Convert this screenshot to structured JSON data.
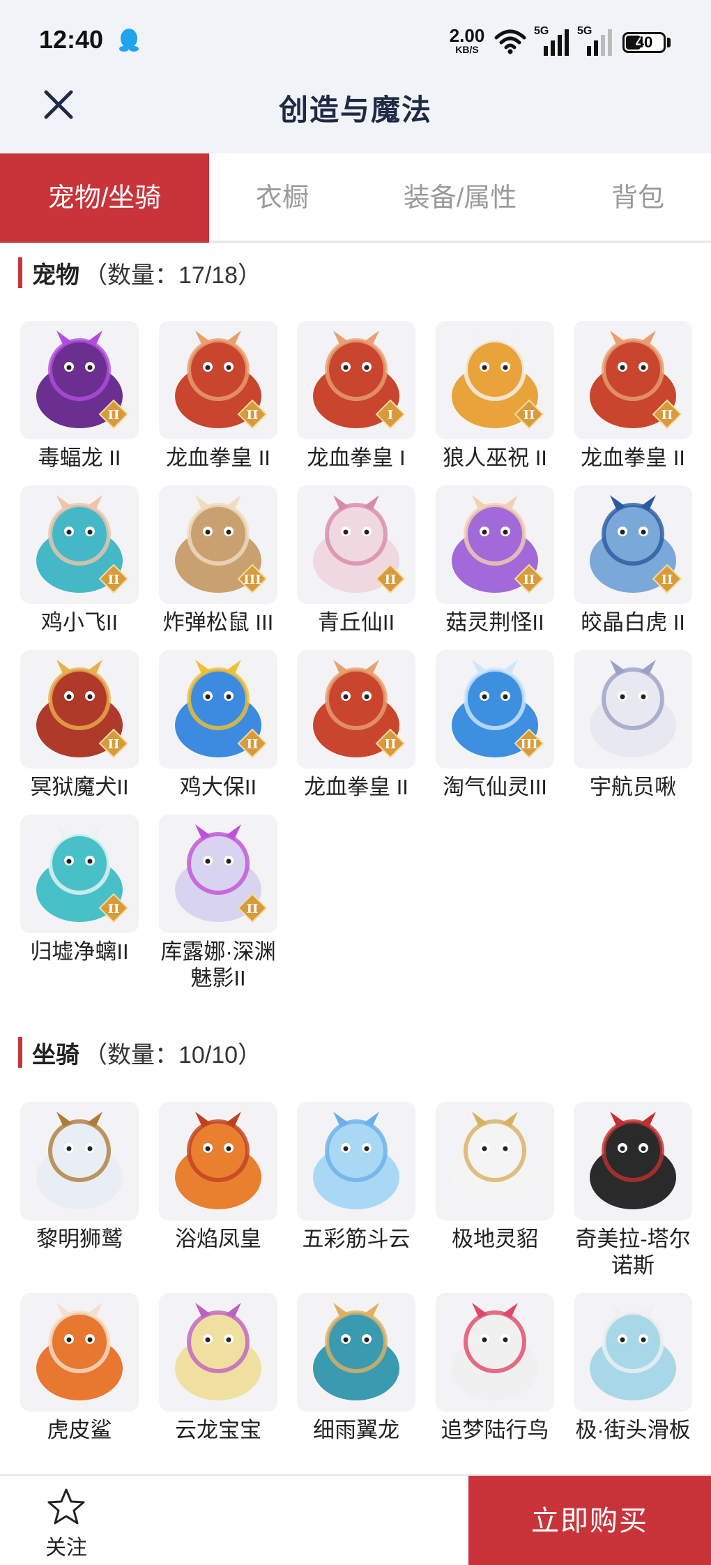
{
  "status_bar": {
    "time": "12:40",
    "net_speed_value": "2.00",
    "net_speed_unit": "KB/S",
    "signal_1_label": "5G",
    "signal_2_label": "5G",
    "battery_level": 40,
    "battery_text": "40"
  },
  "header": {
    "title": "创造与魔法"
  },
  "tabs": [
    {
      "label": "宠物/坐骑",
      "active": true
    },
    {
      "label": "衣橱",
      "active": false
    },
    {
      "label": "装备/属性",
      "active": false
    },
    {
      "label": "背包",
      "active": false
    }
  ],
  "pets_section": {
    "title": "宠物",
    "count": "（数量：17/18）",
    "items": [
      {
        "name": "毒蝠龙 II",
        "tier": "II",
        "color": "#6b2f8f",
        "accent": "#b24ce0"
      },
      {
        "name": "龙血拳皇 II",
        "tier": "II",
        "color": "#c9452e",
        "accent": "#e8a070"
      },
      {
        "name": "龙血拳皇 I",
        "tier": "I",
        "color": "#c9452e",
        "accent": "#e8a070"
      },
      {
        "name": "狼人巫祝 II",
        "tier": "II",
        "color": "#e8a43a",
        "accent": "#f2f2f2"
      },
      {
        "name": "龙血拳皇 II",
        "tier": "II",
        "color": "#c9452e",
        "accent": "#e8a070"
      },
      {
        "name": "鸡小飞II",
        "tier": "II",
        "color": "#45b8c8",
        "accent": "#f0c4a8"
      },
      {
        "name": "炸弹松鼠 III",
        "tier": "III",
        "color": "#c9a070",
        "accent": "#f0dcc0"
      },
      {
        "name": "青丘仙II",
        "tier": "II",
        "color": "#f0d8e0",
        "accent": "#d88aa8"
      },
      {
        "name": "菇灵荆怪II",
        "tier": "II",
        "color": "#a26ad8",
        "accent": "#f3d0b0"
      },
      {
        "name": "皎晶白虎 II",
        "tier": "II",
        "color": "#7aa8d8",
        "accent": "#2c5aa0"
      },
      {
        "name": "冥狱魔犬II",
        "tier": "II",
        "color": "#b03a2a",
        "accent": "#e8b04a"
      },
      {
        "name": "鸡大保II",
        "tier": "II",
        "color": "#3d8be0",
        "accent": "#f0c030"
      },
      {
        "name": "龙血拳皇 II",
        "tier": "II",
        "color": "#c9452e",
        "accent": "#e8a070"
      },
      {
        "name": "淘气仙灵III",
        "tier": "III",
        "color": "#3d8fe0",
        "accent": "#cfe6fa"
      },
      {
        "name": "宇航员啾",
        "tier": "",
        "color": "#e8e8f0",
        "accent": "#9aa0c8"
      },
      {
        "name": "归墟净螭II",
        "tier": "II",
        "color": "#48c0c8",
        "accent": "#e8f4f4"
      },
      {
        "name": "库露娜·深渊魅影II",
        "tier": "II",
        "color": "#d8d4f0",
        "accent": "#c050d8"
      }
    ]
  },
  "mounts_section": {
    "title": "坐骑",
    "count": "（数量：10/10）",
    "items": [
      {
        "name": "黎明狮鹫",
        "color": "#e8eef4",
        "accent": "#b07a3a"
      },
      {
        "name": "浴焰凤皇",
        "color": "#e88030",
        "accent": "#c04020"
      },
      {
        "name": "五彩筋斗云",
        "color": "#a8d8f4",
        "accent": "#6ab0e8"
      },
      {
        "name": "极地灵貂",
        "color": "#f4f4f4",
        "accent": "#d8b060"
      },
      {
        "name": "奇美拉-塔尔诺斯",
        "color": "#2a2a2a",
        "accent": "#c03030"
      },
      {
        "name": "虎皮鲨",
        "color": "#e87830",
        "accent": "#f4e0d0"
      },
      {
        "name": "云龙宝宝",
        "color": "#f0e0a0",
        "accent": "#c060c0"
      },
      {
        "name": "细雨翼龙",
        "color": "#3a9ab0",
        "accent": "#e0b060"
      },
      {
        "name": "追梦陆行鸟",
        "color": "#f0f0f0",
        "accent": "#e04868"
      },
      {
        "name": "极·街头滑板",
        "color": "#a8d8e8",
        "accent": "#f0f0f0"
      }
    ]
  },
  "bottom_bar": {
    "follow_label": "关注",
    "buy_label": "立即购买"
  },
  "colors": {
    "brand_red": "#c8343a",
    "header_bg": "#f0f3f8",
    "title_navy": "#1f2a44",
    "tab_inactive": "#9a9a9a"
  }
}
